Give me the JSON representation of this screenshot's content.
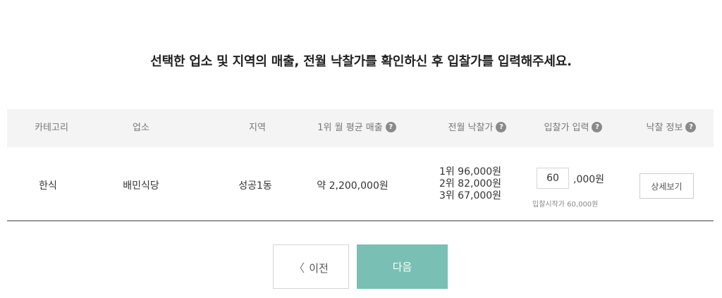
{
  "headline": "선택한 업소 및 지역의 매출, 전월 낙찰가를 확인하신 후 입찰가를 입력해주세요.",
  "table": {
    "headers": {
      "category": "카테고리",
      "business": "업소",
      "region": "지역",
      "avg_sales": "1위 월 평균 매출",
      "last_bid": "전월 낙찰가",
      "bid_input": "입찰가 입력",
      "bid_info": "낙찰 정보"
    },
    "help_glyph": "?",
    "row": {
      "category": "한식",
      "business": "배민식당",
      "region": "성공1동",
      "avg_sales": "약 2,200,000원",
      "last_bid_ranks": [
        "1위 96,000원",
        "2위 82,000원",
        "3위 67,000원"
      ],
      "bid_value": "60",
      "bid_suffix": ",000원",
      "bid_note": "입찰시작가 60,000원",
      "detail_label": "상세보기"
    }
  },
  "nav": {
    "prev_icon": "chevron-left-icon",
    "prev_glyph": "〈",
    "prev_label": "이전",
    "next_label": "다음"
  },
  "colors": {
    "accent": "#79bfb3",
    "header_bg": "#f4f4f4",
    "help_icon": "#8a8a8a"
  }
}
